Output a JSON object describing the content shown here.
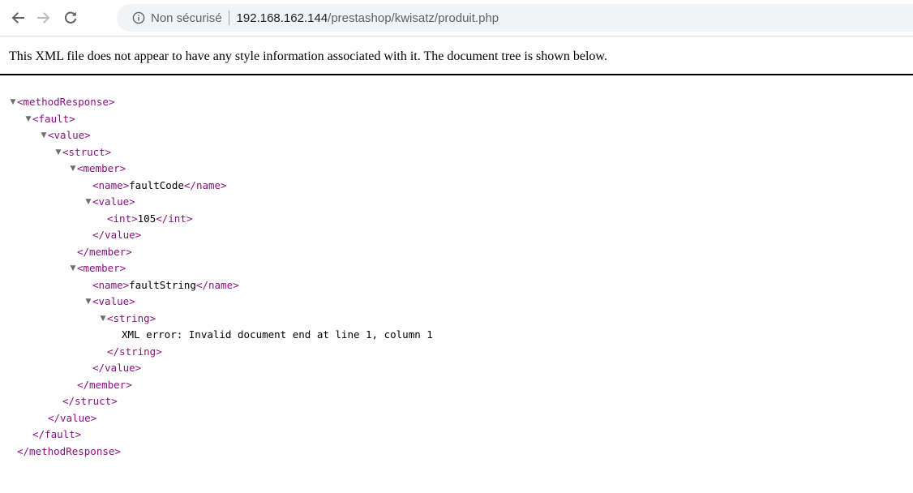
{
  "browser": {
    "back_icon": "arrow-left-icon",
    "forward_icon": "arrow-right-icon",
    "reload_icon": "reload-icon",
    "security_icon": "info-circle-icon",
    "security_label": "Non sécurisé",
    "url_host": "192.168.162.144",
    "url_path": "/prestashop/kwisatz/produit.php"
  },
  "xml_info": {
    "message": "This XML file does not appear to have any style information associated with it. The document tree is shown below."
  },
  "colors": {
    "tag": "#881280",
    "text": "#000000",
    "toggle": "#6e6e6e",
    "omnibox_bg": "#f1f3f4"
  },
  "tree": {
    "toggle_glyph": "▼",
    "methodResponse_open": "<methodResponse>",
    "fault_open": "<fault>",
    "value1_open": "<value>",
    "struct_open": "<struct>",
    "member1_open": "<member>",
    "name1_open": "<name>",
    "name1_text": "faultCode",
    "name1_close": "</name>",
    "value2_open": "<value>",
    "int_open": "<int>",
    "int_text": "105",
    "int_close": "</int>",
    "value2_close": "</value>",
    "member1_close": "</member>",
    "member2_open": "<member>",
    "name2_open": "<name>",
    "name2_text": "faultString",
    "name2_close": "</name>",
    "value3_open": "<value>",
    "string_open": "<string>",
    "string_text": "XML error: Invalid document end at line 1, column 1",
    "string_close": "</string>",
    "value3_close": "</value>",
    "member2_close": "</member>",
    "struct_close": "</struct>",
    "value1_close": "</value>",
    "fault_close": "</fault>",
    "methodResponse_close": "</methodResponse>"
  }
}
